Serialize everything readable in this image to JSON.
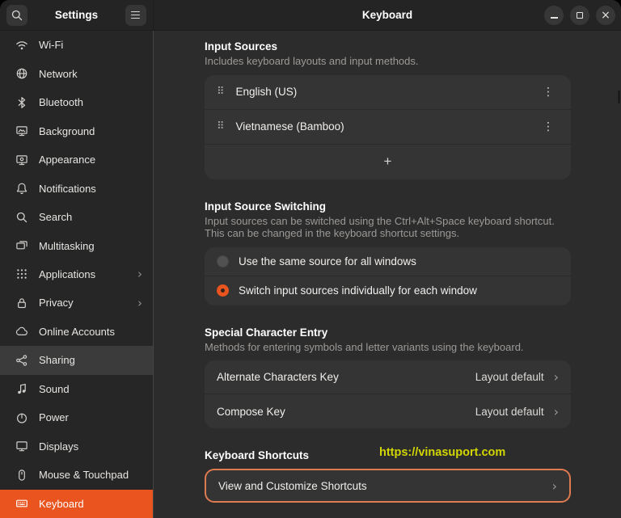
{
  "header": {
    "app_title": "Settings",
    "page_title": "Keyboard"
  },
  "sidebar": {
    "items": [
      {
        "label": "Wi-Fi",
        "icon": "wifi-icon"
      },
      {
        "label": "Network",
        "icon": "globe-icon"
      },
      {
        "label": "Bluetooth",
        "icon": "bluetooth-icon"
      },
      {
        "label": "Background",
        "icon": "picture-icon"
      },
      {
        "label": "Appearance",
        "icon": "appearance-icon"
      },
      {
        "label": "Notifications",
        "icon": "bell-icon"
      },
      {
        "label": "Search",
        "icon": "search-icon"
      },
      {
        "label": "Multitasking",
        "icon": "windows-icon"
      },
      {
        "label": "Applications",
        "icon": "app-grid-icon",
        "has_chevron": true
      },
      {
        "label": "Privacy",
        "icon": "lock-icon",
        "has_chevron": true
      },
      {
        "label": "Online Accounts",
        "icon": "cloud-icon"
      },
      {
        "label": "Sharing",
        "icon": "share-icon",
        "hovered": true
      },
      {
        "label": "Sound",
        "icon": "music-note-icon"
      },
      {
        "label": "Power",
        "icon": "power-icon"
      },
      {
        "label": "Displays",
        "icon": "display-icon"
      },
      {
        "label": "Mouse & Touchpad",
        "icon": "mouse-icon"
      },
      {
        "label": "Keyboard",
        "icon": "keyboard-icon",
        "selected": true
      }
    ],
    "chevron": "›"
  },
  "main": {
    "input_sources": {
      "title": "Input Sources",
      "subtitle": "Includes keyboard layouts and input methods.",
      "sources": [
        {
          "name": "English (US)"
        },
        {
          "name": "Vietnamese (Bamboo)"
        }
      ],
      "add_label": "+"
    },
    "switching": {
      "title": "Input Source Switching",
      "description_line1": "Input sources can be switched using the Ctrl+Alt+Space keyboard shortcut.",
      "description_line2": "This can be changed in the keyboard shortcut settings.",
      "options": [
        {
          "label": "Use the same source for all windows",
          "selected": false
        },
        {
          "label": "Switch input sources individually for each window",
          "selected": true
        }
      ]
    },
    "special_chars": {
      "title": "Special Character Entry",
      "description": "Methods for entering symbols and letter variants using the keyboard.",
      "rows": [
        {
          "label": "Alternate Characters Key",
          "value": "Layout default"
        },
        {
          "label": "Compose Key",
          "value": "Layout default"
        }
      ]
    },
    "shortcuts": {
      "title": "Keyboard Shortcuts",
      "watermark": "https://vinasuport.com",
      "row_label": "View and Customize Shortcuts"
    }
  },
  "colors": {
    "accent_orange": "#E9541F",
    "focus_border_orange": "#DD7A4F",
    "watermark_yellow": "#D2D600",
    "card_background": "#343434",
    "content_background": "#2C2C2C",
    "sidebar_background": "#262626",
    "headerbar_background": "#242424"
  }
}
